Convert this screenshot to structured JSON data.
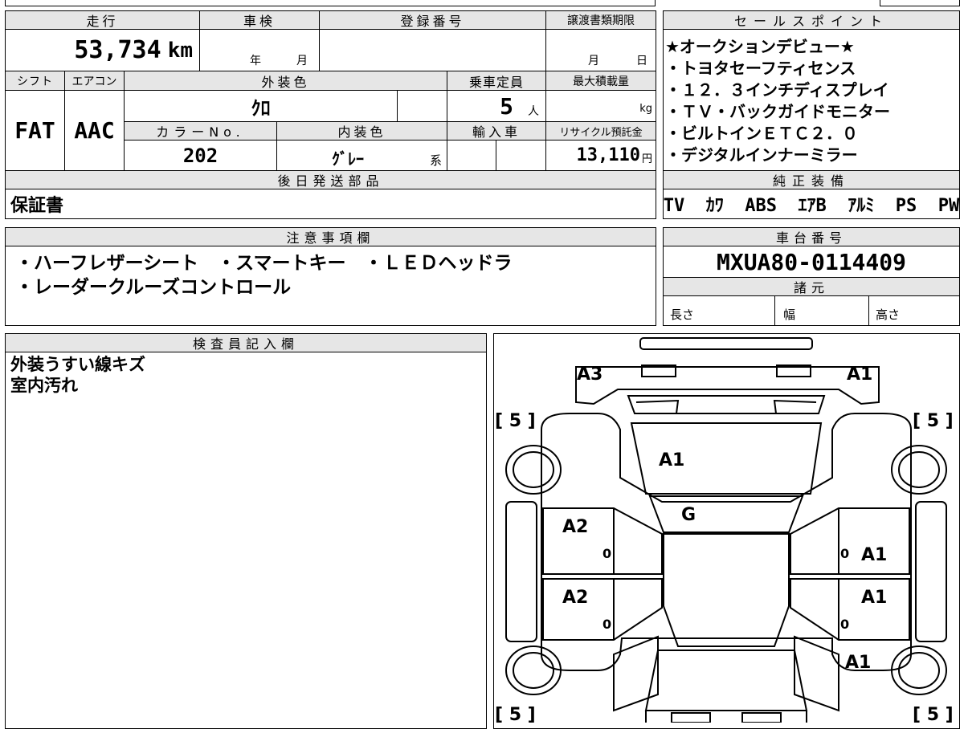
{
  "specs": {
    "mileage": {
      "label": "走行",
      "value": "53,734",
      "unit": "km"
    },
    "shaken": {
      "label": "車検",
      "year_unit": "年",
      "month_unit": "月"
    },
    "registration": {
      "label": "登録番号"
    },
    "doc_deadline": {
      "label": "譲渡書類期限",
      "month_unit": "月",
      "day_unit": "日"
    },
    "shift": {
      "label": "シフト",
      "value": "FAT"
    },
    "aircon": {
      "label": "エアコン",
      "value": "AAC"
    },
    "exterior_color": {
      "label": "外装色",
      "value": "ｸﾛ"
    },
    "capacity": {
      "label": "乗車定員",
      "value": "5",
      "unit": "人"
    },
    "max_load": {
      "label": "最大積載量",
      "unit": "kg"
    },
    "color_no": {
      "label": "カラーNo.",
      "value": "202"
    },
    "interior_color": {
      "label": "内装色",
      "value": "ｸﾞﾚｰ",
      "suffix": "系"
    },
    "import_car": {
      "label": "輸入車"
    },
    "recycle_fee": {
      "label": "リサイクル預託金",
      "value": "13,110",
      "unit": "円"
    },
    "later_parts": {
      "label": "後日発送部品",
      "value": "保証書"
    }
  },
  "sales_points": {
    "label": "セールスポイント",
    "items": [
      "★オークションデビュー★",
      "・トヨタセーフティセンス",
      "・１２．３インチディスプレイ",
      "・ＴＶ・バックガイドモニター",
      "・ビルトインＥＴＣ２．０",
      "・デジタルインナーミラー"
    ]
  },
  "genuine_equipment": {
    "label": "純正装備",
    "value": "TV  ｶﾜ  ABS  ｴｱB  ｱﾙﾐ  PS  PW"
  },
  "notes": {
    "label": "注意事項欄",
    "lines": [
      "・ハーフレザーシート　・スマートキー　・ＬＥＤヘッドラ",
      "・レーダークルーズコントロール"
    ]
  },
  "chassis": {
    "label": "車台番号",
    "value": "MXUA80-0114409"
  },
  "dimensions": {
    "label": "諸元",
    "length": "長さ",
    "width": "幅",
    "height": "高さ"
  },
  "inspector": {
    "label": "検査員記入欄",
    "lines": [
      "外装うすい線キズ",
      "室内汚れ"
    ]
  },
  "diagram": {
    "marks": {
      "front_left": "A3",
      "front_right": "A1",
      "bonnet": "A1",
      "windshield": "G",
      "left_front_door": "A2",
      "left_rear_door": "A2",
      "right_front_door": "A1",
      "right_rear_door": "A1",
      "right_rear_fender": "A1",
      "left_front_door_num": "0",
      "left_rear_door_num": "0",
      "right_front_door_num": "0",
      "right_rear_door_num": "0"
    },
    "tires": {
      "fl": "[ 5 ]",
      "fr": "[ 5 ]",
      "rl": "[ 5 ]",
      "rr": "[ 5 ]"
    }
  }
}
